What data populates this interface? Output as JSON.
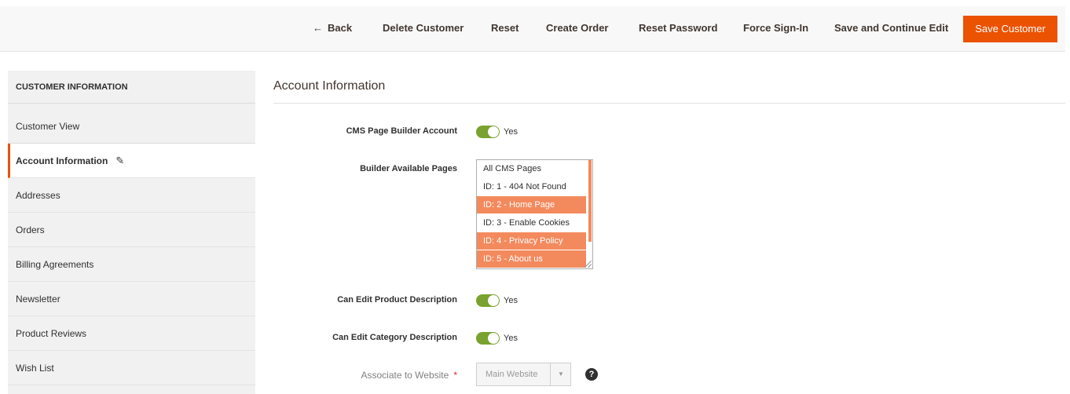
{
  "toolbar": {
    "back_arrow": "←",
    "back_label": "Back",
    "delete_label": "Delete Customer",
    "reset_label": "Reset",
    "create_order_label": "Create Order",
    "reset_password_label": "Reset Password",
    "force_signin_label": "Force Sign-In",
    "save_continue_label": "Save and Continue Edit",
    "save_label": "Save Customer"
  },
  "sidebar": {
    "title": "CUSTOMER INFORMATION",
    "items": [
      {
        "label": "Customer View"
      },
      {
        "label": "Account Information",
        "active": true
      },
      {
        "label": "Addresses"
      },
      {
        "label": "Orders"
      },
      {
        "label": "Billing Agreements"
      },
      {
        "label": "Newsletter"
      },
      {
        "label": "Product Reviews"
      },
      {
        "label": "Wish List"
      }
    ]
  },
  "main": {
    "section_title": "Account Information",
    "cms_builder": {
      "label": "CMS Page Builder Account",
      "value": "Yes",
      "on": true
    },
    "available_pages": {
      "label": "Builder Available Pages",
      "options": [
        {
          "label": "All CMS Pages",
          "selected": false
        },
        {
          "label": "ID: 1 - 404 Not Found",
          "selected": false
        },
        {
          "label": "ID: 2 - Home Page",
          "selected": true
        },
        {
          "label": "ID: 3 - Enable Cookies",
          "selected": false
        },
        {
          "label": "ID: 4 - Privacy Policy",
          "selected": true
        },
        {
          "label": "ID: 5 - About us",
          "selected": true
        }
      ]
    },
    "edit_product": {
      "label": "Can Edit Product Description",
      "value": "Yes",
      "on": true
    },
    "edit_category": {
      "label": "Can Edit Category Description",
      "value": "Yes",
      "on": true
    },
    "website": {
      "label": "Associate to Website",
      "required_mark": "*",
      "value": "Main Website",
      "chevron": "▼",
      "help": "?"
    }
  },
  "colors": {
    "accent": "#eb5202",
    "selected_option": "#f38a5e",
    "toggle_on": "#79a22e"
  },
  "icons": [
    "left-arrow-icon",
    "pencil-icon",
    "chevron-down-icon",
    "help-icon",
    "resize-icon"
  ]
}
